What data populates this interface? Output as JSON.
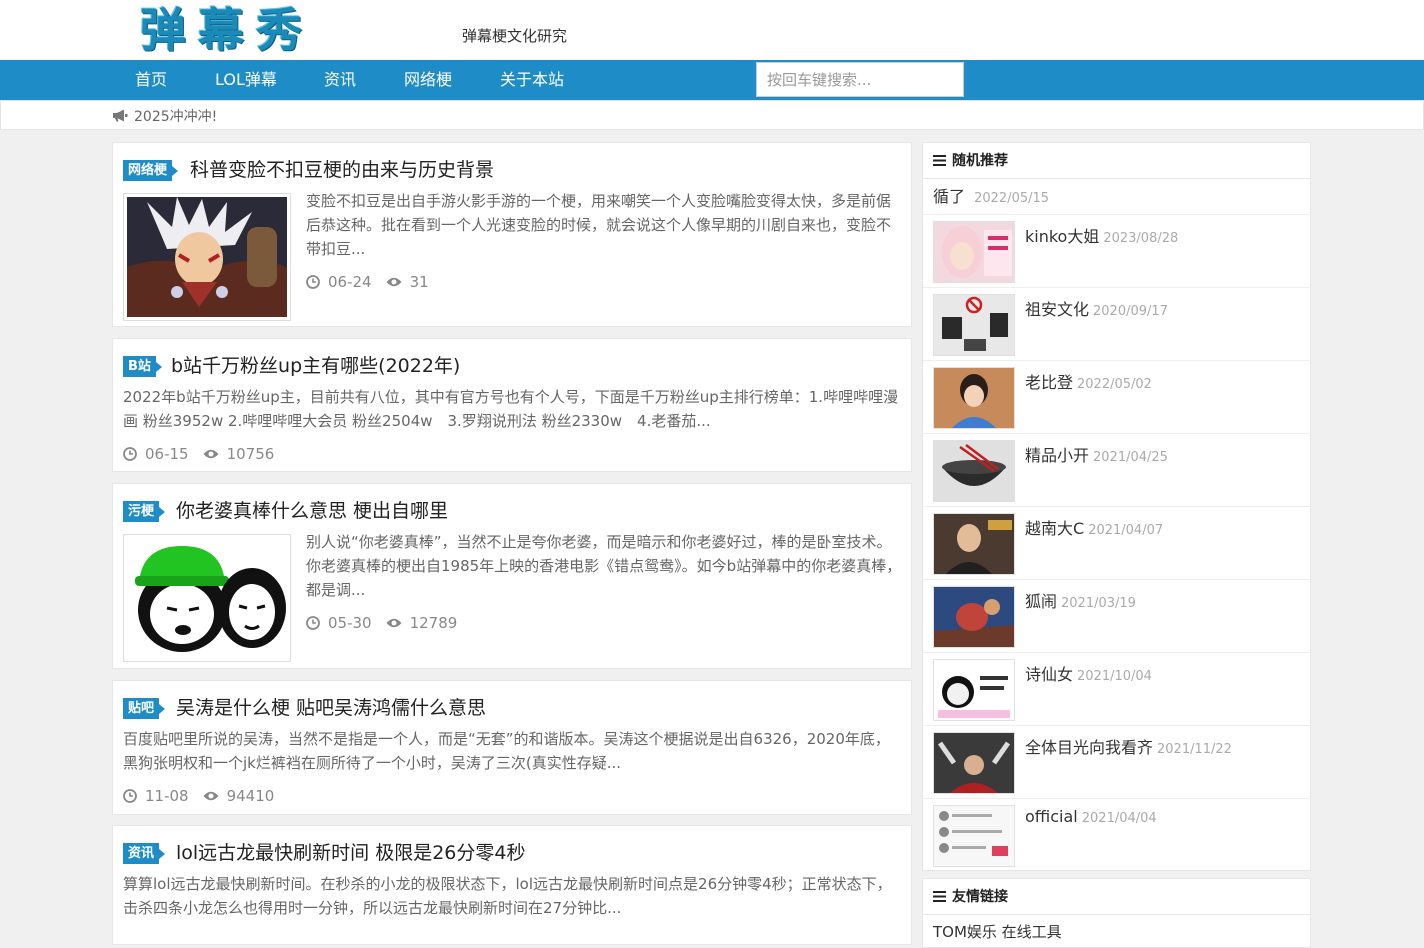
{
  "header": {
    "logo_text": "弹幕秀",
    "tagline": "弹幕梗文化研究"
  },
  "nav": {
    "items": [
      "首页",
      "LOL弹幕",
      "资讯",
      "网络梗",
      "关于本站"
    ],
    "search_placeholder": "按回车键搜索..."
  },
  "notice": {
    "icon": "megaphone-icon",
    "text": "2025冲冲冲!"
  },
  "posts": [
    {
      "tag": "网络梗",
      "title": "科普变脸不扣豆梗的由来与历史背景",
      "excerpt": "变脸不扣豆是出自手游火影手游的一个梗，用来嘲笑一个人变脸嘴脸变得太快，多是前倨后恭这种。批在看到一个人光速变脸的时候，就会说这个人像早期的川剧自来也，变脸不带扣豆...",
      "date": "06-24",
      "views": "31"
    },
    {
      "tag": "B站",
      "title": "b站千万粉丝up主有哪些(2022年)",
      "excerpt": "2022年b站千万粉丝up主，目前共有八位，其中有官方号也有个人号，下面是千万粉丝up主排行榜单：1.哔哩哔哩漫画 粉丝3952w 2.哔哩哔哩大会员 粉丝2504w　3.罗翔说刑法 粉丝2330w　4.老番茄...",
      "date": "06-15",
      "views": "10756"
    },
    {
      "tag": "污梗",
      "title": "你老婆真棒什么意思 梗出自哪里",
      "excerpt": "别人说“你老婆真棒”，当然不止是夸你老婆，而是暗示和你老婆好过，棒的是卧室技术。你老婆真棒的梗出自1985年上映的香港电影《错点鸳鸯》。如今b站弹幕中的你老婆真棒，都是调...",
      "date": "05-30",
      "views": "12789"
    },
    {
      "tag": "贴吧",
      "title": "吴涛是什么梗 贴吧吴涛鸿儒什么意思",
      "excerpt": "百度贴吧里所说的吴涛，当然不是指是一个人，而是“无套”的和谐版本。吴涛这个梗据说是出自6326，2020年底，黑狗张明权和一个jk烂裤裆在厕所待了一个小时，吴涛了三次(真实性存疑...",
      "date": "11-08",
      "views": "94410"
    },
    {
      "tag": "资讯",
      "title": "lol远古龙最快刷新时间 极限是26分零4秒",
      "excerpt": "算算lol远古龙最快刷新时间。在秒杀的小龙的极限状态下，lol远古龙最快刷新时间点是26分钟零4秒；正常状态下，击杀四条小龙怎么也得用时一分钟，所以远古龙最快刷新时间在27分钟比...",
      "date": "",
      "views": ""
    }
  ],
  "sidebar": {
    "random_title": "随机推荐",
    "random_first": {
      "title": "循了",
      "date": "2022/05/15"
    },
    "random_items": [
      {
        "title": "kinko大姐",
        "date": "2023/08/28"
      },
      {
        "title": "祖安文化",
        "date": "2020/09/17"
      },
      {
        "title": "老比登",
        "date": "2022/05/02"
      },
      {
        "title": "精品小开",
        "date": "2021/04/25"
      },
      {
        "title": "越南大C",
        "date": "2021/04/07"
      },
      {
        "title": "狐闹",
        "date": "2021/03/19"
      },
      {
        "title": "诗仙女",
        "date": "2021/10/04"
      },
      {
        "title": "全体目光向我看齐",
        "date": "2021/11/22"
      },
      {
        "title": "official",
        "date": "2021/04/04"
      }
    ],
    "links_title": "友情链接",
    "links_text": "TOM娱乐 在线工具"
  },
  "colors": {
    "primary": "#1e8cc6",
    "logo": "#1a8ab8"
  }
}
